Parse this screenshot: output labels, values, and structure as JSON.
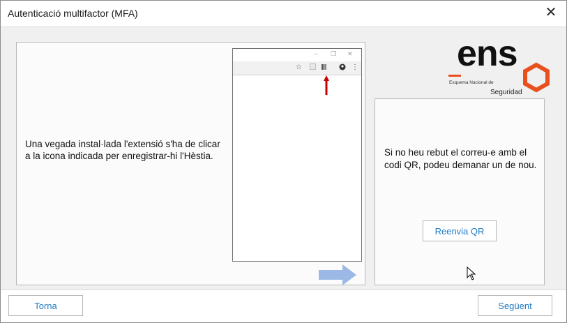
{
  "window": {
    "title": "Autenticació multifactor (MFA)",
    "close_glyph": "✕"
  },
  "left_panel": {
    "instruction": "Una vegada instal·lada l'extensió s'ha de clicar a la icona indicada per enregistrar-hi l'Hèstia."
  },
  "browser_mock": {
    "window_controls": [
      "–",
      "❐",
      "✕"
    ],
    "toolbar_icons": [
      "star-icon",
      "extension-icon",
      "puzzle-icon",
      "account-icon",
      "menu-icon"
    ]
  },
  "right_panel": {
    "message": "Si no heu rebut el correu-e amb el codi QR, podeu demanar un de nou.",
    "resend_label": "Reenvia QR"
  },
  "logo": {
    "text": "ens",
    "subtitle_line1": "Esquema Nacional de",
    "subtitle_line2": "Seguridad"
  },
  "footer": {
    "back_label": "Torna",
    "next_label": "Següent"
  },
  "colors": {
    "accent_link": "#1e7bc4",
    "arrow_red": "#c80000",
    "arrow_blue": "#9cb9e6",
    "logo_orange": "#e8511d"
  }
}
